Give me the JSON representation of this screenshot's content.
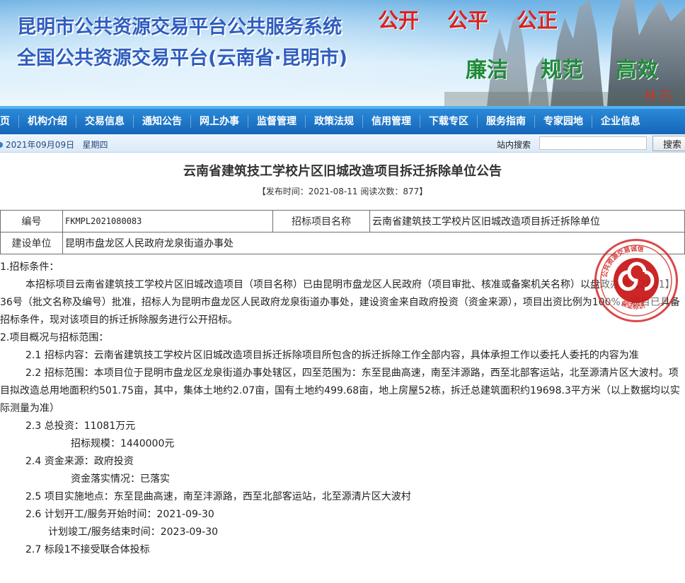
{
  "banner": {
    "title_line1": "昆明市公共资源交易平台公共服务系统",
    "title_line2": "全国公共资源交易平台(云南省·昆明市)",
    "slogans_red": [
      "公开",
      "公平",
      "公正"
    ],
    "slogans_green": [
      "廉洁",
      "规范",
      "高效"
    ],
    "signature": "林石"
  },
  "nav": {
    "items": [
      "首页",
      "机构介绍",
      "交易信息",
      "通知公告",
      "网上办事",
      "监督管理",
      "政策法规",
      "信用管理",
      "下载专区",
      "服务指南",
      "专家园地",
      "企业信息"
    ]
  },
  "datebar": {
    "date": "2021年09月09日",
    "weekday": "星期四",
    "search_label": "站内搜索",
    "search_value": "",
    "search_button": "搜索"
  },
  "article": {
    "title": "云南省建筑技工学校片区旧城改造项目拆迁拆除单位公告",
    "meta": "【发布时间：2021-08-11  阅读次数：877】"
  },
  "info_table": {
    "row1": {
      "label1": "编号",
      "value1": "FKMPL2021080083",
      "label2": "招标项目名称",
      "value2": "云南省建筑技工学校片区旧城改造项目拆迁拆除单位"
    },
    "row2": {
      "label1": "建设单位",
      "value1": "昆明市盘龙区人民政府龙泉街道办事处"
    }
  },
  "content": {
    "s1_title": "1.招标条件：",
    "s1_body": "本招标项目云南省建筑技工学校片区旧城改造项目（项目名称）已由昆明市盘龙区人民政府（项目审批、核准或备案机关名称）以盘政办通【2021】36号（批文名称及编号）批准，招标人为昆明市盘龙区人民政府龙泉街道办事处，建设资金来自政府投资（资金来源），项目出资比例为100%，项目已具备招标条件，现对该项目的拆迁拆除服务进行公开招标。",
    "s2_title": "2.项目概况与招标范围：",
    "s2_1": "2.1 招标内容：云南省建筑技工学校片区旧城改造项目拆迁拆除项目所包含的拆迁拆除工作全部内容，具体承担工作以委托人委托的内容为准",
    "s2_2": "2.2 招标范围：本项目位于昆明市盘龙区龙泉街道办事处辖区，四至范围为：东至昆曲高速，南至沣源路，西至北部客运站，北至源清片区大波村。项目拟改造总用地面积约501.75亩，其中，集体土地约2.07亩，国有土地约499.68亩，地上房屋52栋，拆迁总建筑面积约19698.3平方米（以上数据均以实际测量为准）",
    "s2_3a": "2.3 总投资：11081万元",
    "s2_3b": "招标规模：1440000元",
    "s2_4a": "2.4 资金来源：政府投资",
    "s2_4b": "资金落实情况：已落实",
    "s2_5": "2.5 项目实施地点：东至昆曲高速，南至沣源路，西至北部客运站，北至源清片区大波村",
    "s2_6a": "2.6 计划开工/服务开始时间：2021-09-30",
    "s2_6b": "计划竣工/服务结束时间：2023-09-30",
    "s2_7": "2.7 标段1不接受联合体投标"
  },
  "stamp": {
    "text": "公共资源交易诚信 保证标识"
  },
  "colors": {
    "nav": "#1a6fc4",
    "stamp": "#d62828",
    "banner_title": "#2f5ebf"
  }
}
